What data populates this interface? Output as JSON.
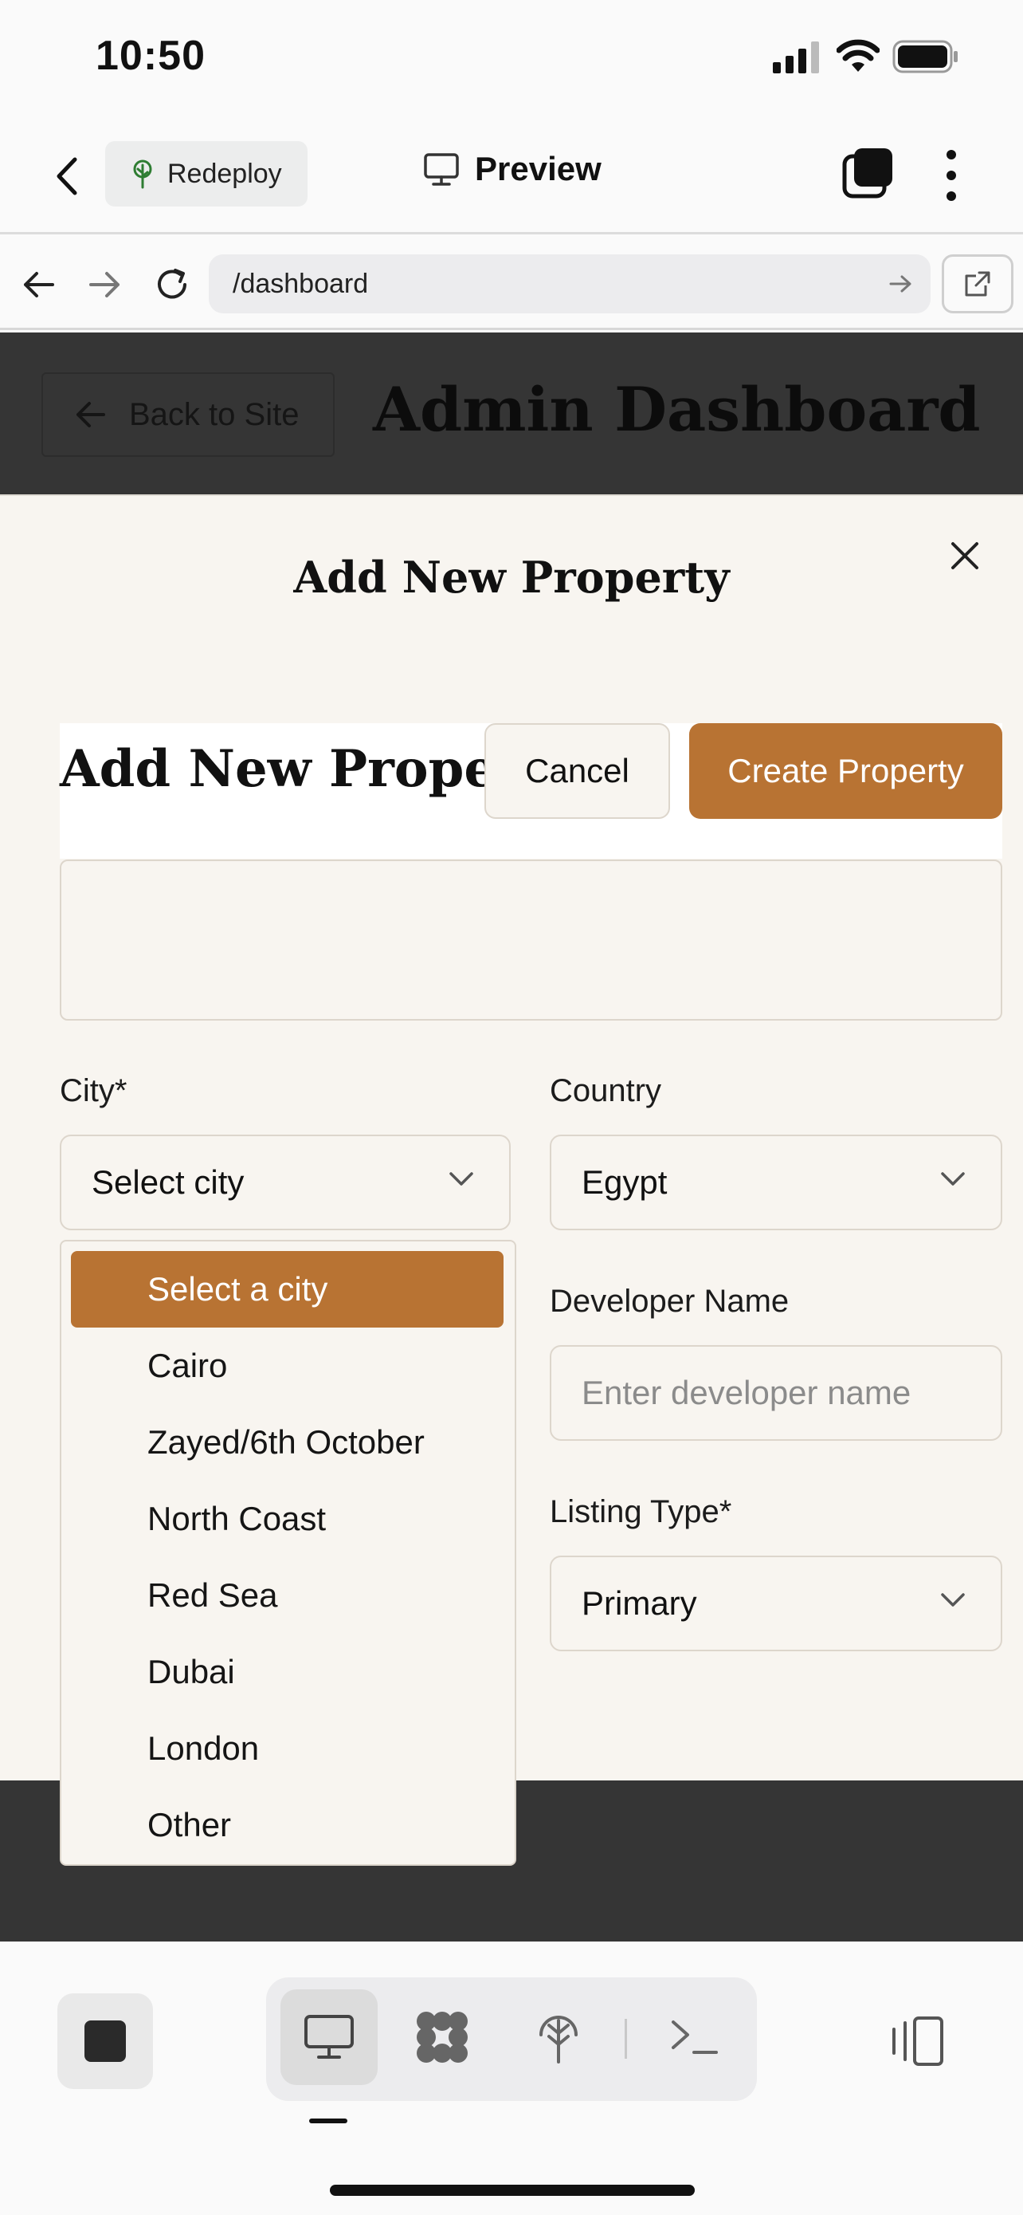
{
  "status_bar": {
    "time": "10:50"
  },
  "app_bar": {
    "redeploy_label": "Redeploy",
    "preview_label": "Preview"
  },
  "browser": {
    "url": "/dashboard"
  },
  "site": {
    "back_label": "Back to Site",
    "title": "Admin Dashboard"
  },
  "modal": {
    "title": "Add New Property",
    "inner_title": "Add New Property",
    "cancel_label": "Cancel",
    "create_label": "Create Property",
    "city_label": "City*",
    "city_value": "Select city",
    "country_label": "Country",
    "country_value": "Egypt",
    "developer_label": "Developer Name",
    "developer_placeholder": "Enter developer name",
    "listing_label": "Listing Type*",
    "listing_value": "Primary"
  },
  "city_options": [
    "Select a city",
    "Cairo",
    "Zayed/6th October",
    "North Coast",
    "Red Sea",
    "Dubai",
    "London",
    "Other"
  ],
  "colors": {
    "accent": "#b87333",
    "modal_bg": "#f8f5f0",
    "site_header": "#353535"
  }
}
